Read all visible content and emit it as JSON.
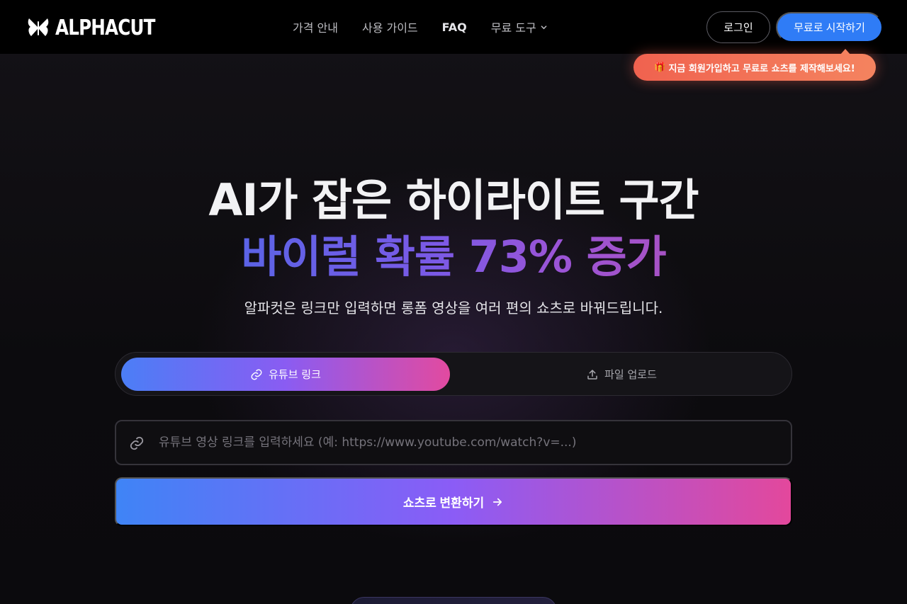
{
  "brand": {
    "name": "ALPHACUT"
  },
  "nav": {
    "links": [
      {
        "label": "가격 안내"
      },
      {
        "label": "사용 가이드"
      },
      {
        "label": "FAQ"
      },
      {
        "label": "무료 도구"
      }
    ],
    "login_label": "로그인",
    "start_label": "무료로 시작하기"
  },
  "promo": {
    "icon": "🎁",
    "text": "지금 회원가입하고 무료로 쇼츠를 제작해보세요!"
  },
  "hero": {
    "title_line1": "AI가 잡은 하이라이트 구간",
    "title_line2": "바이럴 확률 73% 증가",
    "subtitle": "알파컷은 링크만 입력하면 롱폼 영상을 여러 편의 쇼츠로 바꿔드립니다."
  },
  "tabs": {
    "youtube_label": "유튜브 링크",
    "upload_label": "파일 업로드",
    "active": "youtube"
  },
  "url_input": {
    "value": "",
    "placeholder": "유튜브 영상 링크를 입력하세요 (예: https://www.youtube.com/watch?v=...)"
  },
  "convert_button": {
    "label": "쇼츠로 변환하기"
  },
  "colors": {
    "accent_blue": "#2f7cf6",
    "gradient_start": "#3f84f6",
    "gradient_mid": "#8b5cf6",
    "gradient_end": "#e3489c",
    "promo": "#f0624f"
  }
}
